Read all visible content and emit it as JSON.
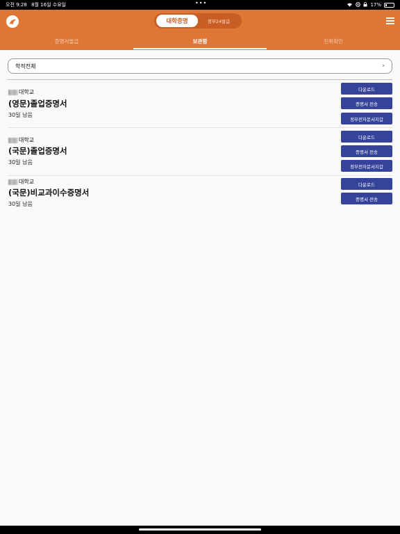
{
  "status_bar": {
    "time": "오전 9:28",
    "date": "8월 16일 수요일",
    "dots": "•••",
    "battery": "17%"
  },
  "header": {
    "segments": [
      "대학증명",
      "정부24발급"
    ],
    "tabs": [
      "증명서발급",
      "보관함",
      "진위확인"
    ],
    "active_tab": "보관함",
    "accent_color": "#e07636",
    "button_color": "#35449a"
  },
  "filter": {
    "label": "학적전체",
    "chevron": "›"
  },
  "documents": [
    {
      "university": "대학교",
      "title": "(영문)졸업증명서",
      "remaining": "30일 남음",
      "buttons": [
        "다운로드",
        "증명서 전송",
        "정부전자문서지갑"
      ]
    },
    {
      "university": "대학교",
      "title": "(국문)졸업증명서",
      "remaining": "30일 남음",
      "buttons": [
        "다운로드",
        "증명서 전송",
        "정부전자문서지갑"
      ]
    },
    {
      "university": "대학교",
      "title": "(국문)비교과이수증명서",
      "remaining": "30일 남음",
      "buttons": [
        "다운로드",
        "증명서 전송"
      ]
    }
  ]
}
